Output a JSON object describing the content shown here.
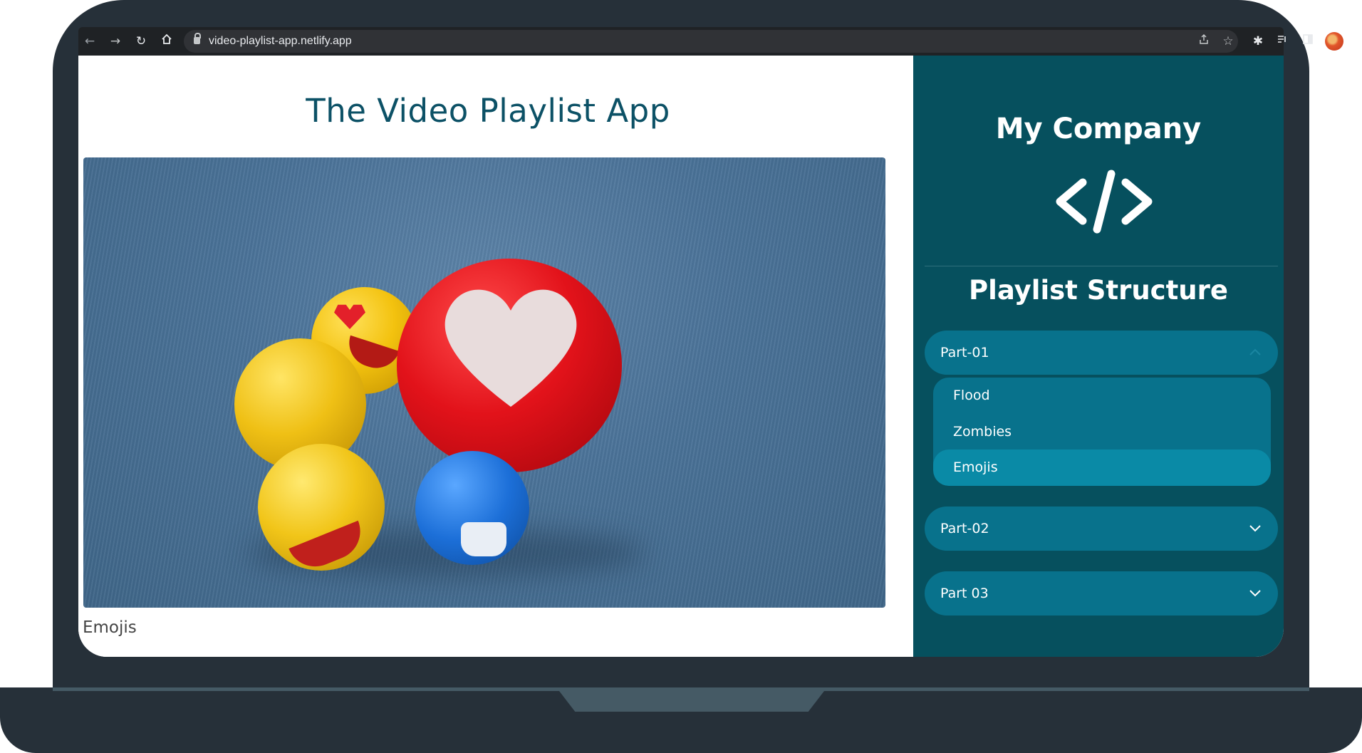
{
  "browser": {
    "url": "video-playlist-app.netlify.app",
    "icons": [
      "back-icon",
      "forward-icon",
      "reload-icon",
      "home-icon",
      "lock-icon",
      "share-icon",
      "star-icon",
      "extensions-icon",
      "media-icon",
      "sidepanel-icon",
      "profile-avatar"
    ]
  },
  "main": {
    "title": "The Video Playlist App",
    "current_video_caption": "Emojis"
  },
  "sidebar": {
    "company": "My Company",
    "logo_icon": "code-brackets-icon",
    "structure_title": "Playlist Structure",
    "parts": [
      {
        "label": "Part-01",
        "expanded": true,
        "videos": [
          {
            "title": "Flood",
            "active": false
          },
          {
            "title": "Zombies",
            "active": false
          },
          {
            "title": "Emojis",
            "active": true
          }
        ]
      },
      {
        "label": "Part-02",
        "expanded": false
      },
      {
        "label": "Part 03",
        "expanded": false
      }
    ]
  },
  "colors": {
    "sidebar_bg": "#06505e",
    "part_bg": "#08728c",
    "active_item_bg": "#0a8aa6",
    "title_color": "#0c5166",
    "laptop_frame": "#263039"
  }
}
